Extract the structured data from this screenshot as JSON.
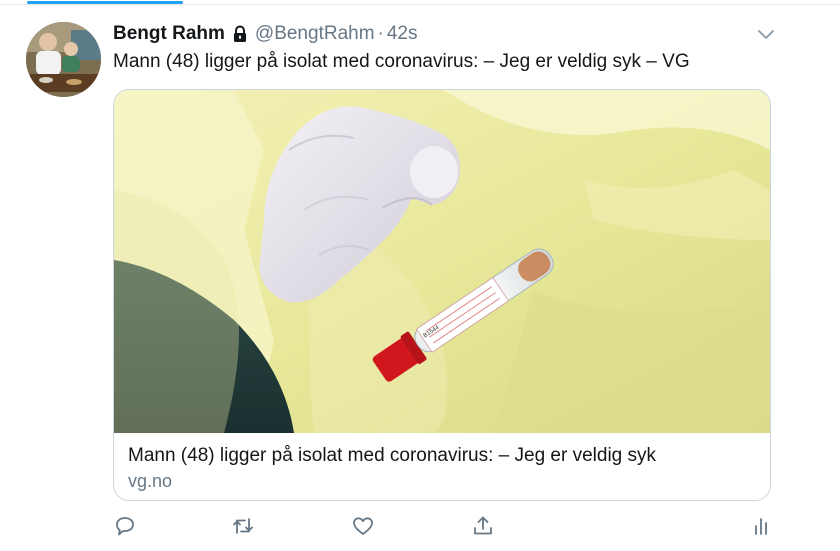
{
  "tweet": {
    "display_name": "Bengt Rahm",
    "handle": "@BengtRahm",
    "separator": "·",
    "timestamp": "42s",
    "text": "Mann (48) ligger på isolat med coronavirus: – Jeg er veldig syk – VG"
  },
  "card": {
    "title": "Mann (48) ligger på isolat med coronavirus: – Jeg er veldig syk",
    "domain": "vg.no",
    "tube_label_text": "B1544"
  },
  "icons": {
    "lock": "lock-icon",
    "chevron": "chevron-down-icon",
    "reply": "reply-icon",
    "retweet": "retweet-icon",
    "like": "heart-icon",
    "share": "share-icon",
    "analytics": "analytics-icon"
  },
  "colors": {
    "accent": "#1da1f2",
    "text": "#14171a",
    "secondary": "#657786",
    "border": "#ccd6dd"
  }
}
